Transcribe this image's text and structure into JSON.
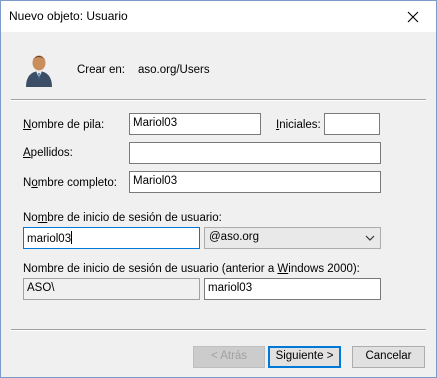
{
  "window": {
    "title": "Nuevo objeto: Usuario"
  },
  "header": {
    "crear_en_label": "Crear en:",
    "crear_en_value": "aso.org/Users"
  },
  "form": {
    "nombre_pila": {
      "label": "Nombre de pila:",
      "value": "Mariol03"
    },
    "iniciales": {
      "label": "Iniciales:",
      "value": ""
    },
    "apellidos": {
      "label": "Apellidos:",
      "value": ""
    },
    "nombre_completo": {
      "label": "Nombre completo:",
      "value": "Mariol03"
    },
    "logon": {
      "label": "Nombre de inicio de sesión de usuario:",
      "value": "mariol03",
      "domain": "@aso.org"
    },
    "pre2000": {
      "label": "Nombre de inicio de sesión de usuario (anterior a Windows 2000):",
      "domain": "ASO\\",
      "value": "mariol03"
    }
  },
  "buttons": {
    "back": "< Atrás",
    "next": "Siguiente >",
    "cancel": "Cancelar"
  },
  "icons": {
    "close": "close-icon",
    "user": "user-icon",
    "dropdown": "chevron-down-icon"
  },
  "colors": {
    "focus_border": "#0078d7",
    "default_button_border": "#0078d7"
  }
}
